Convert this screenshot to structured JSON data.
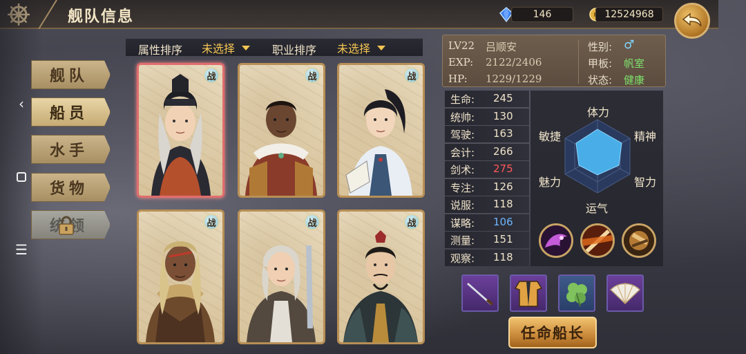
{
  "header": {
    "title": "舰队信息"
  },
  "currency": {
    "gems": "146",
    "gold": "12524968"
  },
  "android_nav": {
    "back": "‹",
    "menu": "☰"
  },
  "menu": [
    {
      "label": "舰队",
      "state": "normal"
    },
    {
      "label": "船员",
      "state": "active"
    },
    {
      "label": "水手",
      "state": "normal"
    },
    {
      "label": "货物",
      "state": "normal"
    },
    {
      "label": "统领",
      "state": "locked"
    }
  ],
  "filters": {
    "attr_label": "属性排序",
    "attr_value": "未选择",
    "job_label": "职业排序",
    "job_value": "未选择"
  },
  "cards": [
    {
      "badge": "战",
      "selected": true
    },
    {
      "badge": "战",
      "selected": false
    },
    {
      "badge": "战",
      "selected": false
    },
    {
      "badge": "战",
      "selected": false
    },
    {
      "badge": "战",
      "selected": false
    },
    {
      "badge": "战",
      "selected": false
    }
  ],
  "info": {
    "level": "LV22",
    "name": "吕顺安",
    "exp_label": "EXP:",
    "exp_value": "2122/2406",
    "hp_label": "HP:",
    "hp_value": "1229/1229",
    "gender_label": "性别:",
    "gender_value": "♂",
    "deck_label": "甲板:",
    "deck_value": "帆室",
    "status_label": "状态:",
    "status_value": "健康"
  },
  "stats": [
    {
      "key": "生命:",
      "value": "245"
    },
    {
      "key": "统帅:",
      "value": "130"
    },
    {
      "key": "驾驶:",
      "value": "163"
    },
    {
      "key": "会计:",
      "value": "266"
    },
    {
      "key": "剑术:",
      "value": "275",
      "color": "red"
    },
    {
      "key": "专注:",
      "value": "126"
    },
    {
      "key": "说服:",
      "value": "118"
    },
    {
      "key": "谋略:",
      "value": "106",
      "color": "blue"
    },
    {
      "key": "测量:",
      "value": "151"
    },
    {
      "key": "观察:",
      "value": "118"
    }
  ],
  "radar": {
    "labels": {
      "top": "体力",
      "tr": "精神",
      "br": "智力",
      "bottom": "运气",
      "bl": "魅力",
      "tl": "敏捷"
    }
  },
  "appoint_button": "任命船长"
}
